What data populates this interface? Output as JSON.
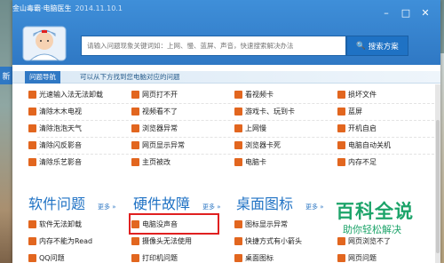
{
  "app": {
    "title": "金山毒霸·电脑医生",
    "version": "2014.11.10.1"
  },
  "side_tab": "新",
  "search": {
    "placeholder": "请输入问题现象关键词如：上网、慢、蓝屏、声音，快速搜索解决办法",
    "button_label": "搜索方案"
  },
  "nav": {
    "active_label": "问题导航",
    "hint": "可以从下方找到您电脑对应的问题"
  },
  "grid": {
    "rows": [
      [
        "光速输入法无法卸载",
        "网页打不开",
        "看视频卡",
        "损坏文件"
      ],
      [
        "清除木木电视",
        "视频看不了",
        "游戏卡、玩到卡",
        "蓝屏"
      ],
      [
        "清除泡泡天气",
        "浏览器异常",
        "上网慢",
        "开机自启"
      ],
      [
        "清除闪反影音",
        "网页显示异常",
        "浏览器卡死",
        "电脑自动关机"
      ],
      [
        "清除乐艺影音",
        "主页被改",
        "电脑卡",
        "内存不足"
      ]
    ]
  },
  "categories": [
    {
      "title": "软件问题",
      "more": "更多",
      "items": [
        "软件无法卸载",
        "内存不能为Read",
        "QQ问题"
      ]
    },
    {
      "title": "硬件故障",
      "more": "更多",
      "items": [
        "电脑没声音",
        "摄像头无法使用",
        "打印机问题"
      ]
    },
    {
      "title": "桌面图标",
      "more": "更多",
      "items": [
        "图标显示异常",
        "快捷方式有小箭头",
        "桌面图标"
      ]
    },
    {
      "title": "",
      "more": "",
      "items": [
        "",
        "网页浏览不了",
        "网页问题"
      ]
    }
  ],
  "watermark": {
    "line1": "百科全说",
    "line2": "助你轻松解决"
  },
  "colors": {
    "accent": "#2f78c4",
    "icon": "#e2661f",
    "highlight": "#e02020",
    "watermark": "#1da46a"
  },
  "window_controls": [
    "minimize-icon",
    "maximize-icon",
    "close-icon"
  ]
}
